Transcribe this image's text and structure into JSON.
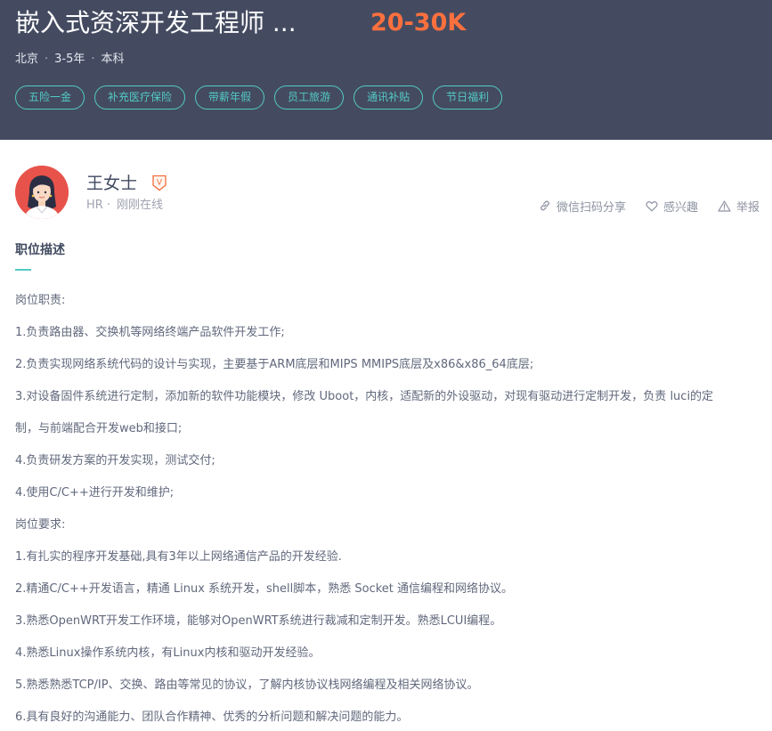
{
  "job": {
    "title": "嵌入式资深开发工程师 ...",
    "salary": "20-30K",
    "city": "北京",
    "experience": "3-5年",
    "education": "本科",
    "meta_separator": "·",
    "tags": [
      "五险一金",
      "补充医疗保险",
      "带薪年假",
      "员工旅游",
      "通讯补贴",
      "节日福利"
    ]
  },
  "recruiter": {
    "name": "王女士",
    "verify_badge": "V",
    "role": "HR",
    "separator": "·",
    "online_status": "刚刚在线"
  },
  "actions": {
    "share": "微信扫码分享",
    "interest": "感兴趣",
    "report": "举报"
  },
  "description": {
    "title": "职位描述",
    "lines": [
      "岗位职责:",
      "1.负责路由器、交换机等网络终端产品软件开发工作;",
      "2.负责实现网络系统代码的设计与实现，主要基于ARM底层和MIPS MMIPS底层及x86&x86_64底层;",
      "3.对设备固件系统进行定制，添加新的软件功能模块，修改 Uboot，内核，适配新的外设驱动，对现有驱动进行定制开发，负责 luci的定",
      "制，与前端配合开发web和接口;",
      "4.负责研发方案的开发实现，测试交付;",
      "4.使用C/C++进行开发和维护;",
      "岗位要求:",
      "1.有扎实的程序开发基础,具有3年以上网络通信产品的开发经验.",
      "2.精通C/C++开发语言，精通 Linux 系统开发，shell脚本，熟悉 Socket 通信编程和网络协议。",
      "3.熟悉OpenWRT开发工作环境，能够对OpenWRT系统进行裁减和定制开发。熟悉LCUI编程。",
      "4.熟悉Linux操作系统内核，有Linux内核和驱动开发经验。",
      "5.熟悉熟悉TCP/IP、交换、路由等常见的协议，了解内核协议栈网络编程及相关网络协议。",
      "6.具有良好的沟通能力、团队合作精神、优秀的分析问题和解决问题的能力。"
    ]
  },
  "colors": {
    "header_bg": "#444b61",
    "salary": "#fc703e",
    "accent": "#53cac3",
    "verify": "#f26d3d",
    "avatar_bg": "#e7534b"
  }
}
